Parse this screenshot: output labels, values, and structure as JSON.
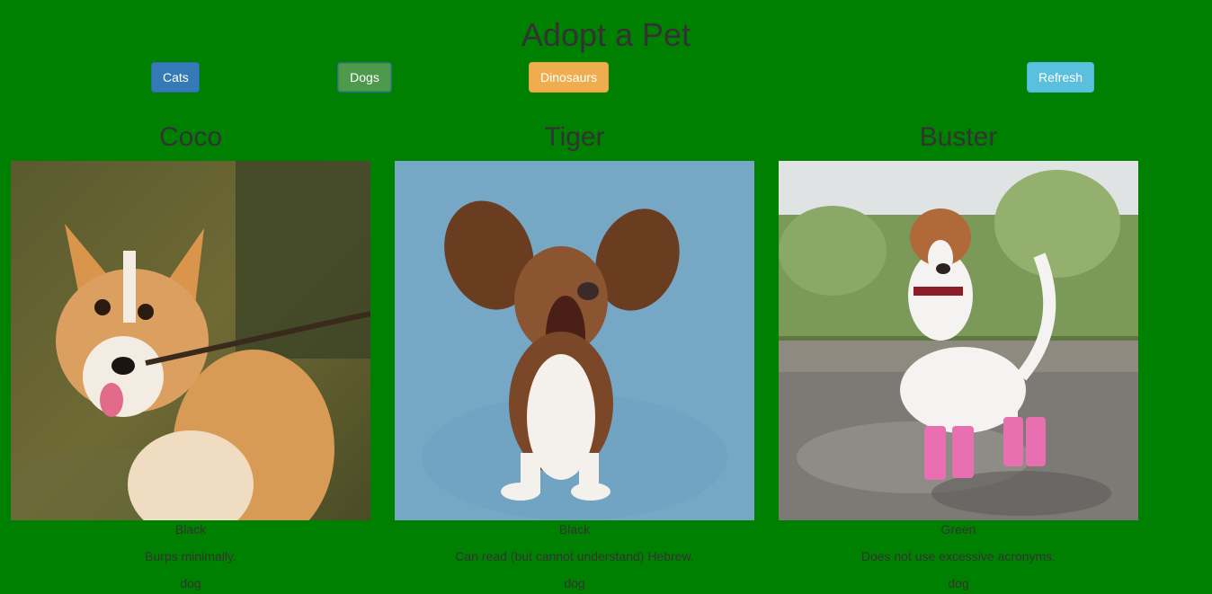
{
  "header": {
    "title": "Adopt a Pet"
  },
  "buttons": {
    "cats": "Cats",
    "dogs": "Dogs",
    "dinosaurs": "Dinosaurs",
    "refresh": "Refresh"
  },
  "colors": {
    "background": "#008000",
    "cats_button": "#337ab7",
    "dogs_button": "#4d9a4d",
    "dinosaurs_button": "#f0ad4e",
    "refresh_button": "#5bc0de"
  },
  "pets": [
    {
      "name": "Coco",
      "color": "Black",
      "description": "Burps minimally.",
      "type": "dog",
      "photo": "corgi-with-stick"
    },
    {
      "name": "Tiger",
      "color": "Black",
      "description": "Can read (but cannot understand) Hebrew.",
      "type": "dog",
      "photo": "basset-hound-ears-flying"
    },
    {
      "name": "Buster",
      "color": "Green",
      "description": "Does not use excessive acronyms.",
      "type": "dog",
      "photo": "terrier-in-pink-boots"
    }
  ]
}
